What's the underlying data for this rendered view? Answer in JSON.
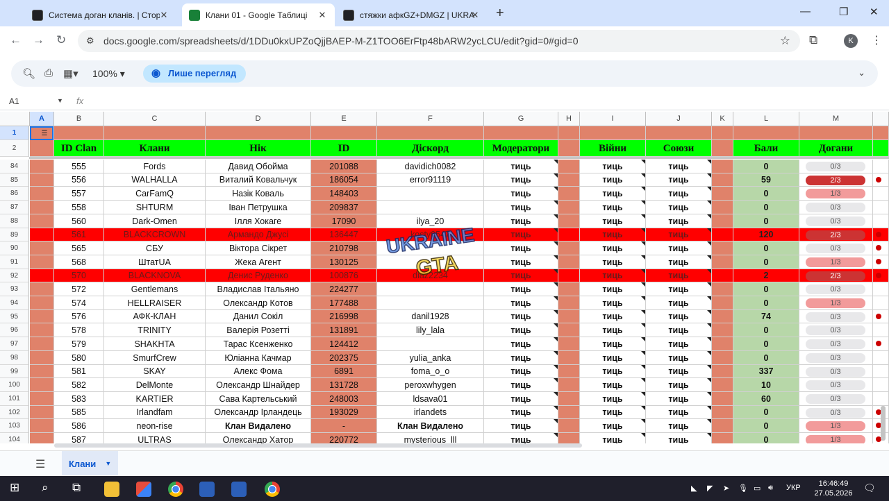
{
  "browser": {
    "tabs": [
      {
        "title": "Система доган кланів. | Сторі",
        "favicon": "dark"
      },
      {
        "title": "Клани 01 - Google Таблиці",
        "favicon": "sheets"
      },
      {
        "title": "стяжки афкGZ+DMGZ | UKRAI",
        "favicon": "dark"
      }
    ],
    "url": "docs.google.com/spreadsheets/d/1DDu0kxUPZoQjjBAEP-M-Z1TOO6ErFtp48bARW2ycLCU/edit?gid=0#gid=0",
    "profile_initial": "K"
  },
  "toolbar": {
    "zoom": "100%",
    "mode_label": "Лише перегляд"
  },
  "formula_bar": {
    "cell_ref": "A1",
    "fx": "fx"
  },
  "columns": [
    "A",
    "B",
    "C",
    "D",
    "E",
    "F",
    "G",
    "H",
    "I",
    "J",
    "K",
    "L",
    "M"
  ],
  "header_row": {
    "num": "2",
    "B": "ID Clan",
    "C": "Клани",
    "D": "Нік",
    "E": "ID",
    "F": "Діскорд",
    "G": "Модератори",
    "I": "Війни",
    "J": "Союзи",
    "L": "Бали",
    "M": "Догани"
  },
  "row1_num": "1",
  "rows": [
    {
      "n": "84",
      "id": "555",
      "clan": "Fords",
      "nick": "Давид Обойма",
      "gid": "201088",
      "discord": "davidich0082",
      "mod": "тиць",
      "war": "тиць",
      "ally": "тиць",
      "points": "0",
      "warn": "0/3",
      "warn_level": 0,
      "red": false,
      "dot": false
    },
    {
      "n": "85",
      "id": "556",
      "clan": "WALHALLA",
      "nick": "Виталий Ковальчук",
      "gid": "186054",
      "discord": "error91119",
      "mod": "тиць",
      "war": "тиць",
      "ally": "тиць",
      "points": "59",
      "warn": "2/3",
      "warn_level": 2,
      "red": false,
      "dot": true
    },
    {
      "n": "86",
      "id": "557",
      "clan": "CarFamQ",
      "nick": "Назік Коваль",
      "gid": "148403",
      "discord": "",
      "mod": "тиць",
      "war": "тиць",
      "ally": "тиць",
      "points": "0",
      "warn": "1/3",
      "warn_level": 1,
      "red": false,
      "dot": false
    },
    {
      "n": "87",
      "id": "558",
      "clan": "SHTURM",
      "nick": "Іван Петрушка",
      "gid": "209837",
      "discord": "",
      "mod": "тиць",
      "war": "тиць",
      "ally": "тиць",
      "points": "0",
      "warn": "0/3",
      "warn_level": 0,
      "red": false,
      "dot": false
    },
    {
      "n": "88",
      "id": "560",
      "clan": "Dark-Omen",
      "nick": "Ілля Хокаге",
      "gid": "17090",
      "discord": "ilya_20",
      "mod": "тиць",
      "war": "тиць",
      "ally": "тиць",
      "points": "0",
      "warn": "0/3",
      "warn_level": 0,
      "red": false,
      "dot": false
    },
    {
      "n": "89",
      "id": "561",
      "clan": "BLACKCROWN",
      "nick": "Армандо Джусі",
      "gid": "136447",
      "discord": "kosty0547",
      "mod": "тиць",
      "war": "тиць",
      "ally": "тиць",
      "points": "120",
      "warn": "2/3",
      "warn_level": 2,
      "red": true,
      "dot": true
    },
    {
      "n": "90",
      "id": "565",
      "clan": "СБУ",
      "nick": "Віктора Сікрет",
      "gid": "210798",
      "discord": "",
      "mod": "тиць",
      "war": "тиць",
      "ally": "тиць",
      "points": "0",
      "warn": "0/3",
      "warn_level": 0,
      "red": false,
      "dot": true
    },
    {
      "n": "91",
      "id": "568",
      "clan": "ШтатUA",
      "nick": "Жека Агент",
      "gid": "130125",
      "discord": "",
      "mod": "тиць",
      "war": "тиць",
      "ally": "тиць",
      "points": "0",
      "warn": "1/3",
      "warn_level": 1,
      "red": false,
      "dot": true
    },
    {
      "n": "92",
      "id": "570",
      "clan": "BLACKNOVA",
      "nick": "Денис Руденко",
      "gid": "100876",
      "discord": "diaz2234",
      "mod": "тиць",
      "war": "тиць",
      "ally": "тиць",
      "points": "2",
      "warn": "2/3",
      "warn_level": 2,
      "red": true,
      "dot": true
    },
    {
      "n": "93",
      "id": "572",
      "clan": "Gentlemans",
      "nick": "Владислав Італьяно",
      "gid": "224277",
      "discord": "",
      "mod": "тиць",
      "war": "тиць",
      "ally": "тиць",
      "points": "0",
      "warn": "0/3",
      "warn_level": 0,
      "red": false,
      "dot": false
    },
    {
      "n": "94",
      "id": "574",
      "clan": "HELLRAISER",
      "nick": "Олександр Котов",
      "gid": "177488",
      "discord": "",
      "mod": "тиць",
      "war": "тиць",
      "ally": "тиць",
      "points": "0",
      "warn": "1/3",
      "warn_level": 1,
      "red": false,
      "dot": false
    },
    {
      "n": "95",
      "id": "576",
      "clan": "АФК-КЛАН",
      "nick": "Данил Сокіл",
      "gid": "216998",
      "discord": "danil1928",
      "mod": "тиць",
      "war": "тиць",
      "ally": "тиць",
      "points": "74",
      "warn": "0/3",
      "warn_level": 0,
      "red": false,
      "dot": true
    },
    {
      "n": "96",
      "id": "578",
      "clan": "TRINITY",
      "nick": "Валерія Розетті",
      "gid": "131891",
      "discord": "lily_lala",
      "mod": "тиць",
      "war": "тиць",
      "ally": "тиць",
      "points": "0",
      "warn": "0/3",
      "warn_level": 0,
      "red": false,
      "dot": false
    },
    {
      "n": "97",
      "id": "579",
      "clan": "SHAKHTA",
      "nick": "Тарас Ксенженко",
      "gid": "124412",
      "discord": "",
      "mod": "тиць",
      "war": "тиць",
      "ally": "тиць",
      "points": "0",
      "warn": "0/3",
      "warn_level": 0,
      "red": false,
      "dot": true
    },
    {
      "n": "98",
      "id": "580",
      "clan": "SmurfCrew",
      "nick": "Юліанна Качмар",
      "gid": "202375",
      "discord": "yulia_anka",
      "mod": "тиць",
      "war": "тиць",
      "ally": "тиць",
      "points": "0",
      "warn": "0/3",
      "warn_level": 0,
      "red": false,
      "dot": false
    },
    {
      "n": "99",
      "id": "581",
      "clan": "SKAY",
      "nick": "Алекс Фома",
      "gid": "6891",
      "discord": "foma_o_o",
      "mod": "тиць",
      "war": "тиць",
      "ally": "тиць",
      "points": "337",
      "warn": "0/3",
      "warn_level": 0,
      "red": false,
      "dot": false
    },
    {
      "n": "100",
      "id": "582",
      "clan": "DelMonte",
      "nick": "Олександр Шнайдер",
      "gid": "131728",
      "discord": "peroxwhygen",
      "mod": "тиць",
      "war": "тиць",
      "ally": "тиць",
      "points": "10",
      "warn": "0/3",
      "warn_level": 0,
      "red": false,
      "dot": false
    },
    {
      "n": "101",
      "id": "583",
      "clan": "KARTIER",
      "nick": "Сава Картельський",
      "gid": "248003",
      "discord": "ldsava01",
      "mod": "тиць",
      "war": "тиць",
      "ally": "тиць",
      "points": "60",
      "warn": "0/3",
      "warn_level": 0,
      "red": false,
      "dot": false
    },
    {
      "n": "102",
      "id": "585",
      "clan": "Irlandfam",
      "nick": "Олександр Ірландець",
      "gid": "193029",
      "discord": "irlandets",
      "mod": "тиць",
      "war": "тиць",
      "ally": "тиць",
      "points": "0",
      "warn": "0/3",
      "warn_level": 0,
      "red": false,
      "dot": true
    },
    {
      "n": "103",
      "id": "586",
      "clan": "neon-rise",
      "nick": "Клан Видалено",
      "gid": "-",
      "discord": "Клан Видалено",
      "mod": "тиць",
      "war": "тиць",
      "ally": "тиць",
      "points": "0",
      "warn": "1/3",
      "warn_level": 1,
      "red": false,
      "dot": true,
      "deleted": true
    },
    {
      "n": "104",
      "id": "587",
      "clan": "ULTRAS",
      "nick": "Олександр Хатор",
      "gid": "220772",
      "discord": "mysterious_lll",
      "mod": "тиць",
      "war": "тиць",
      "ally": "тиць",
      "points": "0",
      "warn": "1/3",
      "warn_level": 1,
      "red": false,
      "dot": true
    }
  ],
  "sheet_tab": "Клани",
  "taskbar": {
    "time": "16:46:49",
    "date": "27.05.2026",
    "lang": "УКР"
  },
  "colors": {
    "salmon": "#e0826a",
    "green_header": "#00ff00",
    "light_green": "#b7d7a8",
    "red_row": "#ff0000",
    "accent": "#0b57d0"
  }
}
